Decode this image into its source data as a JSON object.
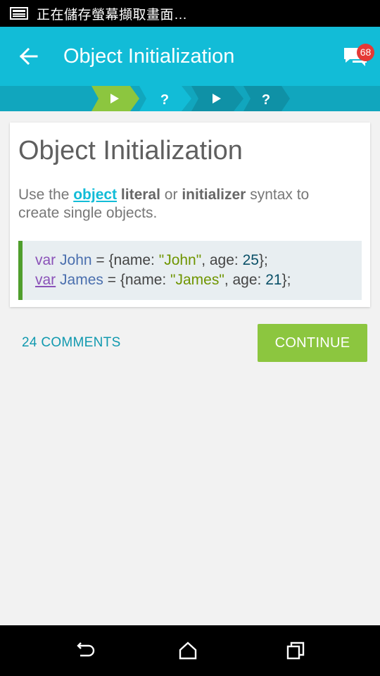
{
  "status_bar": {
    "text": "正在儲存螢幕擷取畫面…",
    "icon": "screenshot-icon"
  },
  "app_bar": {
    "title": "Object Initialization",
    "back_icon": "arrow-left-icon",
    "comments_icon": "chat-bubbles-icon",
    "notification_count": "68",
    "background": "#12bcd7"
  },
  "progress": {
    "steps": [
      {
        "icon": "play-icon",
        "state": "current",
        "color": "#8cc63f"
      },
      {
        "label": "?",
        "state": "locked",
        "color": "#12bcd7"
      },
      {
        "icon": "play-icon",
        "state": "locked",
        "color": "#0f91a6"
      },
      {
        "label": "?",
        "state": "locked",
        "color": "#0f91a6"
      }
    ]
  },
  "lesson": {
    "title": "Object Initialization",
    "desc": {
      "use_the": "Use the",
      "object": "object",
      "literal": "literal",
      "or": "or",
      "initializer": "initializer",
      "syntax_to": "syntax to",
      "line2": "create single objects."
    },
    "code": [
      {
        "kw": "var",
        "ident": "John",
        "assign": " = {name: ",
        "str": "\"John\"",
        "mid": ", age: ",
        "num": "25",
        "end": "};"
      },
      {
        "kw": "var",
        "ident": "James",
        "assign": " = {name: ",
        "str": "\"James\"",
        "mid": ", age: ",
        "num": "21",
        "end": "};"
      }
    ]
  },
  "actions": {
    "comments_label": "24 COMMENTS",
    "continue_label": "CONTINUE",
    "continue_color": "#8cc63f"
  },
  "nav_bar": {
    "back_icon": "back-icon",
    "home_icon": "home-icon",
    "recents_icon": "recents-icon"
  }
}
